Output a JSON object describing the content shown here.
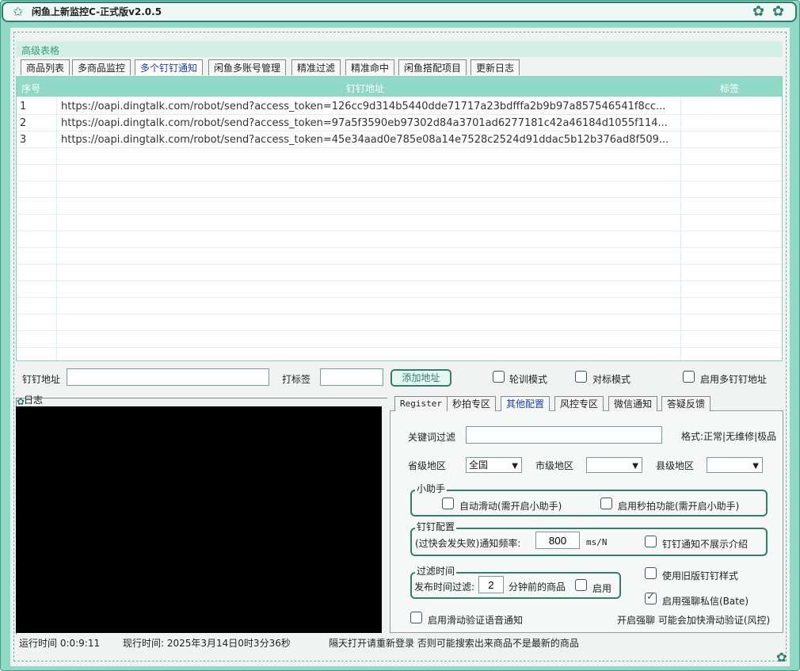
{
  "app": {
    "title": "闲鱼上新监控C-正式版v2.0.5"
  },
  "group": {
    "title": "高级表格"
  },
  "tabs": [
    {
      "label": "商品列表"
    },
    {
      "label": "多商品监控"
    },
    {
      "label": "多个钉钉通知"
    },
    {
      "label": "闲鱼多账号管理"
    },
    {
      "label": "精准过滤"
    },
    {
      "label": "精准命中"
    },
    {
      "label": "闲鱼搭配项目"
    },
    {
      "label": "更新日志"
    }
  ],
  "table": {
    "headers": {
      "index": "序号",
      "url": "钉钉地址",
      "tag": "标签"
    },
    "rows": [
      {
        "index": "1",
        "url": "https://oapi.dingtalk.com/robot/send?access_token=126cc9d314b5440dde71717a23bdfffa2b9b97a857546541f8cc...",
        "tag": ""
      },
      {
        "index": "2",
        "url": "https://oapi.dingtalk.com/robot/send?access_token=97a5f3590eb97302d84a3701ad6277181c42a46184d1055f114...",
        "tag": ""
      },
      {
        "index": "3",
        "url": "https://oapi.dingtalk.com/robot/send?access_token=45e34aad0e785e08a14e7528c2524d91ddac5b12b376ad8f509...",
        "tag": ""
      }
    ]
  },
  "form": {
    "url_label": "钉钉地址",
    "url_value": "",
    "tag_label": "打标签",
    "tag_value": "",
    "add_button": "添加地址",
    "poll_mode": "轮训模式",
    "target_mode": "对标模式",
    "multi_enable": "启用多钉钉地址"
  },
  "log": {
    "title": "日志"
  },
  "right_tabs": [
    {
      "label": "Register"
    },
    {
      "label": "秒拍专区"
    },
    {
      "label": "其他配置"
    },
    {
      "label": "风控专区"
    },
    {
      "label": "微信通知"
    },
    {
      "label": "答疑反馈"
    }
  ],
  "config": {
    "keyword_label": "关键词过滤",
    "keyword_value": "",
    "format_hint": "格式:正常|无维修|极品",
    "province_label": "省级地区",
    "province_value": "全国",
    "city_label": "市级地区",
    "city_value": "",
    "county_label": "县级地区",
    "county_value": "",
    "helper_title": "小助手",
    "auto_slide": "自动滑动(需开启小助手)",
    "flash_buy": "启用秒拍功能(需开启小助手)",
    "ding_title": "钉钉配置",
    "freq_label": "(过快会发失败)通知频率:",
    "freq_value": "800",
    "freq_unit": "ms/N",
    "no_intro": "钉钉通知不展示介绍",
    "filter_title": "过滤时间",
    "publish_label": "发布时间过滤:",
    "publish_value": "2",
    "publish_suffix": "分钟前的商品",
    "publish_enable": "启用",
    "old_style": "使用旧版钉钉样式",
    "private_chat": "启用强聊私信(Bate)",
    "slide_voice": "启用滑动验证语音通知",
    "strong_chat_hint": "开启强聊 可能会加快滑动验证(风控)"
  },
  "status": {
    "runtime": "运行时间 0:0:9:11",
    "now": "现行时间: 2025年3月14日0时3分36秒",
    "notice": "隔天打开请重新登录 否则可能搜索出来商品不是最新的商品"
  }
}
